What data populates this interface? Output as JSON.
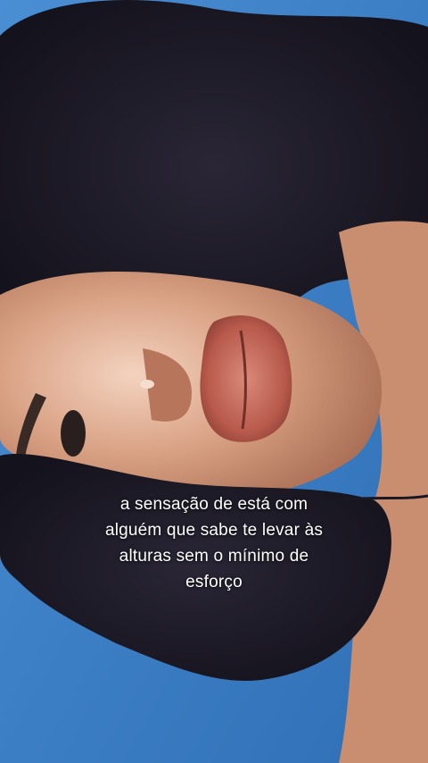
{
  "video": {
    "caption_lines": [
      "a sensação de está com",
      "alguém que sabe te levar às",
      "alturas sem o mínimo de",
      "esforço"
    ]
  },
  "colors": {
    "background": "#3b7fc6",
    "hair": "#1c1a26",
    "skin": "#d9a184",
    "lips": "#b85a4c"
  }
}
